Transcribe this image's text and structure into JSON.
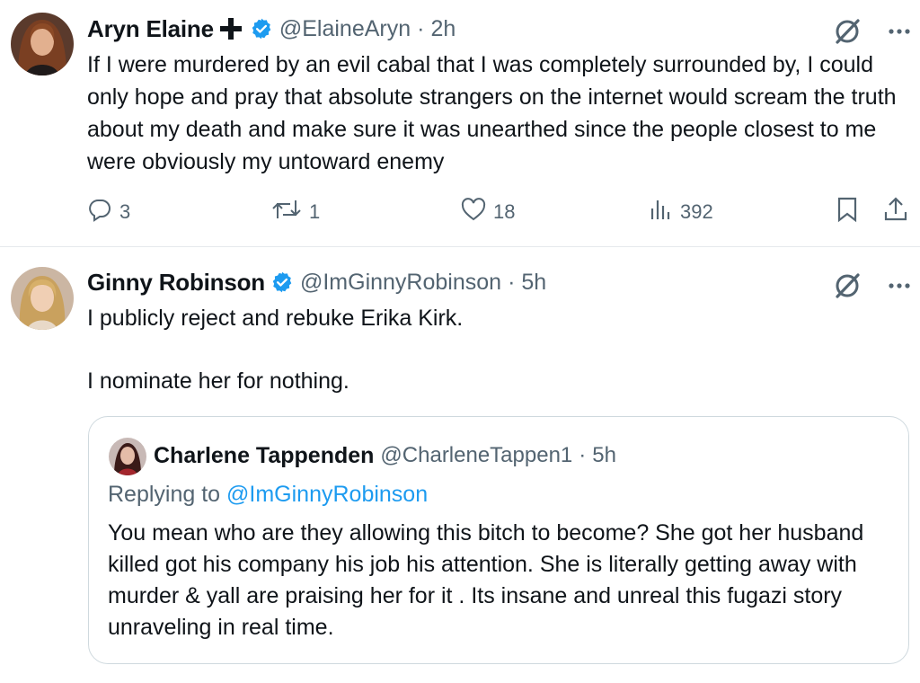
{
  "post1": {
    "author_name": "Aryn Elaine",
    "name_emoji": "cross-icon",
    "verified": true,
    "handle": "@ElaineAryn",
    "separator": "·",
    "time": "2h",
    "text": "If I were murdered by an evil cabal that I was completely surrounded by, I could only hope and pray that absolute strangers on the internet would scream the truth about my death and make sure it was unearthed since the people closest to me were obviously my untoward enemy",
    "replies": "3",
    "reposts": "1",
    "likes": "18",
    "views": "392",
    "icons": [
      "grok-icon",
      "more-icon",
      "reply-icon",
      "repost-icon",
      "like-icon",
      "views-icon",
      "bookmark-icon",
      "share-icon"
    ]
  },
  "post2": {
    "author_name": "Ginny Robinson",
    "verified": true,
    "handle": "@ImGinnyRobinson",
    "separator": "·",
    "time": "5h",
    "text_line1": "I publicly reject and rebuke Erika Kirk.",
    "text_line2": "I nominate her for nothing.",
    "icons": [
      "grok-icon",
      "more-icon"
    ],
    "quoted": {
      "author_name": "Charlene Tappenden",
      "handle": "@CharleneTappen1",
      "separator": "·",
      "time": "5h",
      "replying_prefix": "Replying to ",
      "replying_handle": "@ImGinnyRobinson",
      "text": "You mean who are they allowing this bitch to become? She got her husband killed got his company his job his attention. She is literally getting away with murder & yall are praising her for it . Its insane and unreal this fugazi story unraveling in real time."
    }
  },
  "colors": {
    "text": "#0f1419",
    "secondary": "#536471",
    "link": "#1d9bf0",
    "verified": "#1d9bf0",
    "border": "#cfd9de"
  }
}
